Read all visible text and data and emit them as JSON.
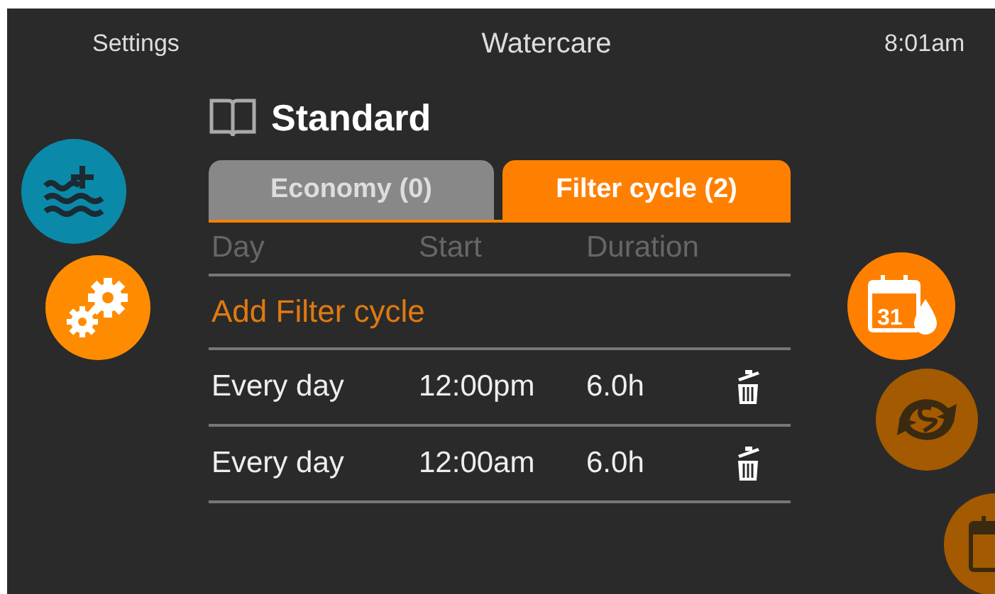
{
  "header": {
    "left": "Settings",
    "title": "Watercare",
    "time": "8:01am"
  },
  "mode": {
    "title": "Standard"
  },
  "tabs": [
    {
      "label": "Economy (0)",
      "selected": false
    },
    {
      "label": "Filter cycle (2)",
      "selected": true
    }
  ],
  "table": {
    "columns": [
      "Day",
      "Start",
      "Duration"
    ],
    "add_label": "Add Filter cycle",
    "rows": [
      {
        "day": "Every day",
        "start": "12:00pm",
        "duration": "6.0h"
      },
      {
        "day": "Every day",
        "start": "12:00am",
        "duration": "6.0h"
      }
    ]
  },
  "left_buttons": [
    {
      "kind": "water",
      "color": "#0a8aa8"
    },
    {
      "kind": "gears",
      "color": "#ff8c00"
    }
  ],
  "right_buttons": [
    {
      "kind": "calendar-drop",
      "active": true,
      "number": "31"
    },
    {
      "kind": "sync",
      "active": false
    },
    {
      "kind": "calendar",
      "active": false
    }
  ]
}
